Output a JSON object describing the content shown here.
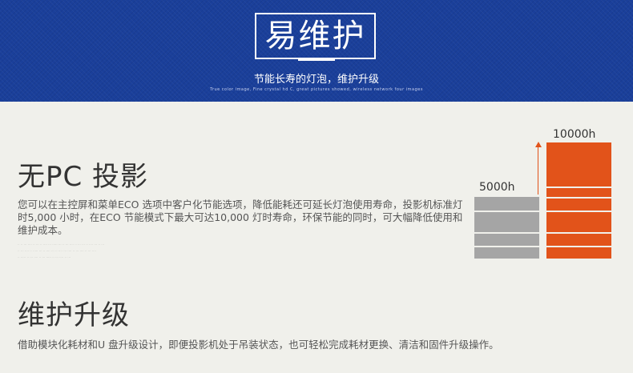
{
  "banner": {
    "title": "易维护",
    "subtitle": "节能长寿的灯泡，维护升级",
    "english_line": "True color image, Fine crystal hd C, great pictures showed, wireless network four images"
  },
  "section1": {
    "heading": "无PC 投影",
    "paragraph": "您可以在主控屏和菜单ECO 选项中客户化节能选项，降低能耗还可延长灯泡使用寿命，投影机标准灯时5,000 小时，在ECO 节能模式下最大可达10,000 灯时寿命，环保节能的同时，可大幅降低使用和维护成本。"
  },
  "chart_data": {
    "type": "bar",
    "categories": [
      "5000h",
      "10000h"
    ],
    "values": [
      5000,
      10000
    ],
    "data_labels": [
      "5000h",
      "10000h"
    ],
    "colors": [
      "#a5a5a5",
      "#e2531a"
    ]
  },
  "section2": {
    "heading": "维护升级",
    "paragraph": "借助模块化耗材和U 盘升级设计，即便投影机处于吊装状态，也可轻松完成耗材更换、清洁和固件升级操作。"
  },
  "colors": {
    "banner": "#1a3f9a",
    "accent": "#e2531a",
    "gray_bar": "#a5a5a5",
    "background": "#f0f0eb"
  }
}
